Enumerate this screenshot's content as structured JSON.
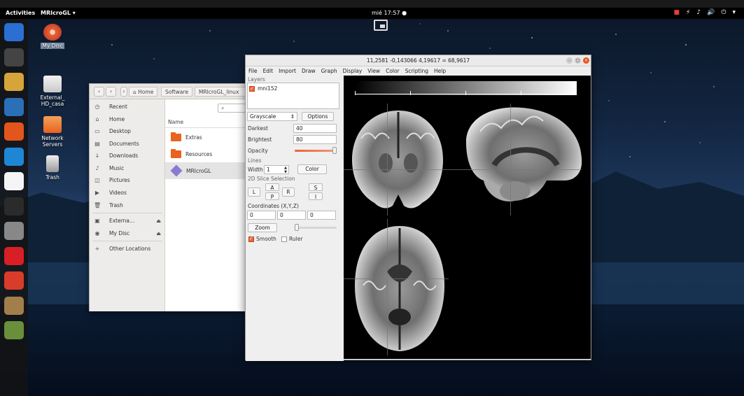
{
  "topbar": {
    "activities": "Activities",
    "app_name": "MRIcroGL ▾",
    "clock": "mié 17:57 ●",
    "tray": [
      "■",
      "⚡",
      "♪",
      "🔊",
      "⏻",
      "▾"
    ]
  },
  "desktop_icons": [
    {
      "label": "My Disc"
    },
    {
      "label": "External_\nHD_casa"
    },
    {
      "label": "Network\nServers"
    },
    {
      "label": "Trash"
    }
  ],
  "dock": {
    "colors": [
      "#2a6fd1",
      "#444",
      "#d7a43a",
      "#2b6fb8",
      "#e2551d",
      "#1f86d6",
      "#f5f5f5",
      "#2b2b2b",
      "#888",
      "#d81f26",
      "#d93c2b",
      "#a27f4a",
      "#6a8f3b"
    ]
  },
  "files": {
    "breadcrumbs": [
      "Home",
      "Software",
      "MRIcroGL_linux"
    ],
    "sidebar": [
      {
        "icon": "◷",
        "label": "Recent"
      },
      {
        "icon": "⌂",
        "label": "Home"
      },
      {
        "icon": "▭",
        "label": "Desktop"
      },
      {
        "icon": "▤",
        "label": "Documents"
      },
      {
        "icon": "↓",
        "label": "Downloads"
      },
      {
        "icon": "♪",
        "label": "Music"
      },
      {
        "icon": "◫",
        "label": "Pictures"
      },
      {
        "icon": "▶",
        "label": "Videos"
      },
      {
        "icon": "🗑",
        "label": "Trash"
      },
      {
        "icon": "▣",
        "label": "Externa…"
      },
      {
        "icon": "◉",
        "label": "My Disc"
      },
      {
        "icon": "+",
        "label": "Other Locations"
      }
    ],
    "column_name": "Name",
    "items": [
      {
        "name": "Extras",
        "type": "folder"
      },
      {
        "name": "Resources",
        "type": "folder"
      },
      {
        "name": "MRIcroGL",
        "type": "app"
      }
    ]
  },
  "mri": {
    "title": "11,2581 -0,143066 4,19617 = 68,9617",
    "menu": [
      "File",
      "Edit",
      "Import",
      "Draw",
      "Graph",
      "Display",
      "View",
      "Color",
      "Scripting",
      "Help"
    ],
    "layers_label": "Layers",
    "layer_name": "mni152",
    "colormap": "Grayscale",
    "options_label": "Options",
    "darkest_label": "Darkest",
    "darkest_value": "40",
    "brightest_label": "Brightest",
    "brightest_value": "80",
    "opacity_label": "Opacity",
    "opacity_level": 1.0,
    "lines_label": "Lines",
    "width_label": "Width",
    "width_value": "1",
    "color_label": "Color",
    "slice_label": "2D Slice Selection",
    "slice_buttons": {
      "L": "L",
      "A": "A",
      "P": "P",
      "R": "R",
      "S": "S",
      "I": "I"
    },
    "coords_label": "Coordinates (X,Y,Z)",
    "coords": [
      "0",
      "0",
      "0"
    ],
    "zoom_label": "Zoom",
    "zoom_level": 0.0,
    "smooth_label": "Smooth",
    "ruler_label": "Ruler"
  }
}
